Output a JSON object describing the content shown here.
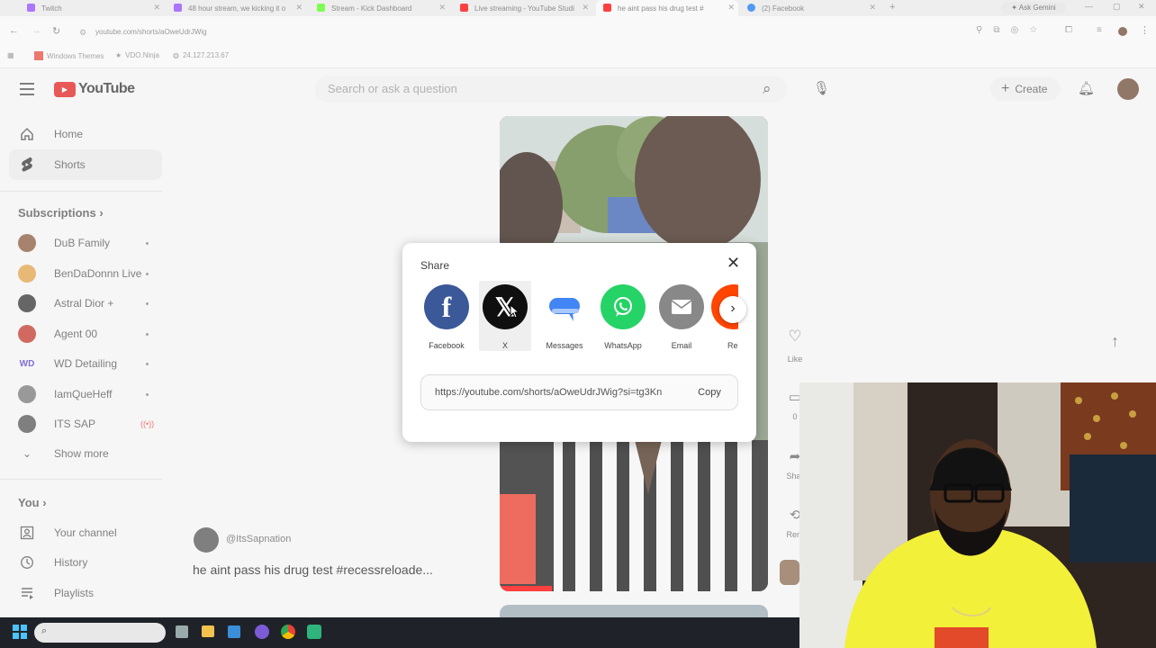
{
  "browser": {
    "tabs": [
      {
        "title": "Twitch",
        "color": "#9146ff"
      },
      {
        "title": "48 hour stream, we kicking it o",
        "color": "#9146ff"
      },
      {
        "title": "Stream - Kick Dashboard",
        "color": "#53fc18"
      },
      {
        "title": "Live streaming - YouTube Studi",
        "color": "#ff0000"
      },
      {
        "title": "he aint pass his drug test #",
        "color": "#ff0000"
      },
      {
        "title": "(2) Facebook",
        "color": "#1877f2"
      }
    ],
    "ask_gemini": "Ask Gemini",
    "url": "youtube.com/shorts/aOweUdrJWig",
    "bookmarks": [
      "Windows Themes",
      "VDO.Ninja",
      "24.127.213.67"
    ]
  },
  "youtube": {
    "logo_text": "YouTube",
    "search_placeholder": "Search or ask a question",
    "create_label": "Create",
    "sidebar": {
      "home": "Home",
      "shorts": "Shorts",
      "subscriptions_title": "Subscriptions",
      "subscriptions": [
        {
          "name": "DuB Family",
          "color": "#8a5a3c"
        },
        {
          "name": "BenDaDonnn Live",
          "color": "#e0a04a"
        },
        {
          "name": "Astral Dior +",
          "color": "#333333"
        },
        {
          "name": "Agent 00",
          "color": "#c0392b"
        },
        {
          "name": "WD Detailing",
          "color": "#5a3cc8"
        },
        {
          "name": "IamQueHeff",
          "color": "#777777"
        },
        {
          "name": "ITS SAP",
          "color": "#555555"
        }
      ],
      "show_more": "Show more",
      "you_title": "You",
      "you_items": [
        "Your channel",
        "History",
        "Playlists"
      ]
    },
    "short": {
      "channel": "@ItsSapnation",
      "title": "he aint pass his drug test #recessreloade..."
    },
    "actions": {
      "like": "Like",
      "comment_count": "0",
      "share": "Shar",
      "remix": "Rem"
    }
  },
  "share_modal": {
    "title": "Share",
    "options": [
      {
        "label": "Facebook",
        "color": "#3b5998",
        "icon": "f"
      },
      {
        "label": "X",
        "color": "#0f0f0f",
        "icon": "X"
      },
      {
        "label": "Messages",
        "color": "#4285f4",
        "icon": ""
      },
      {
        "label": "WhatsApp",
        "color": "#25d366",
        "icon": ""
      },
      {
        "label": "Email",
        "color": "#888888",
        "icon": ""
      },
      {
        "label": "Re",
        "color": "#ff4500",
        "icon": ""
      }
    ],
    "link": "https://youtube.com/shorts/aOweUdrJWig?si=tg3Kn",
    "copy_label": "Copy"
  }
}
